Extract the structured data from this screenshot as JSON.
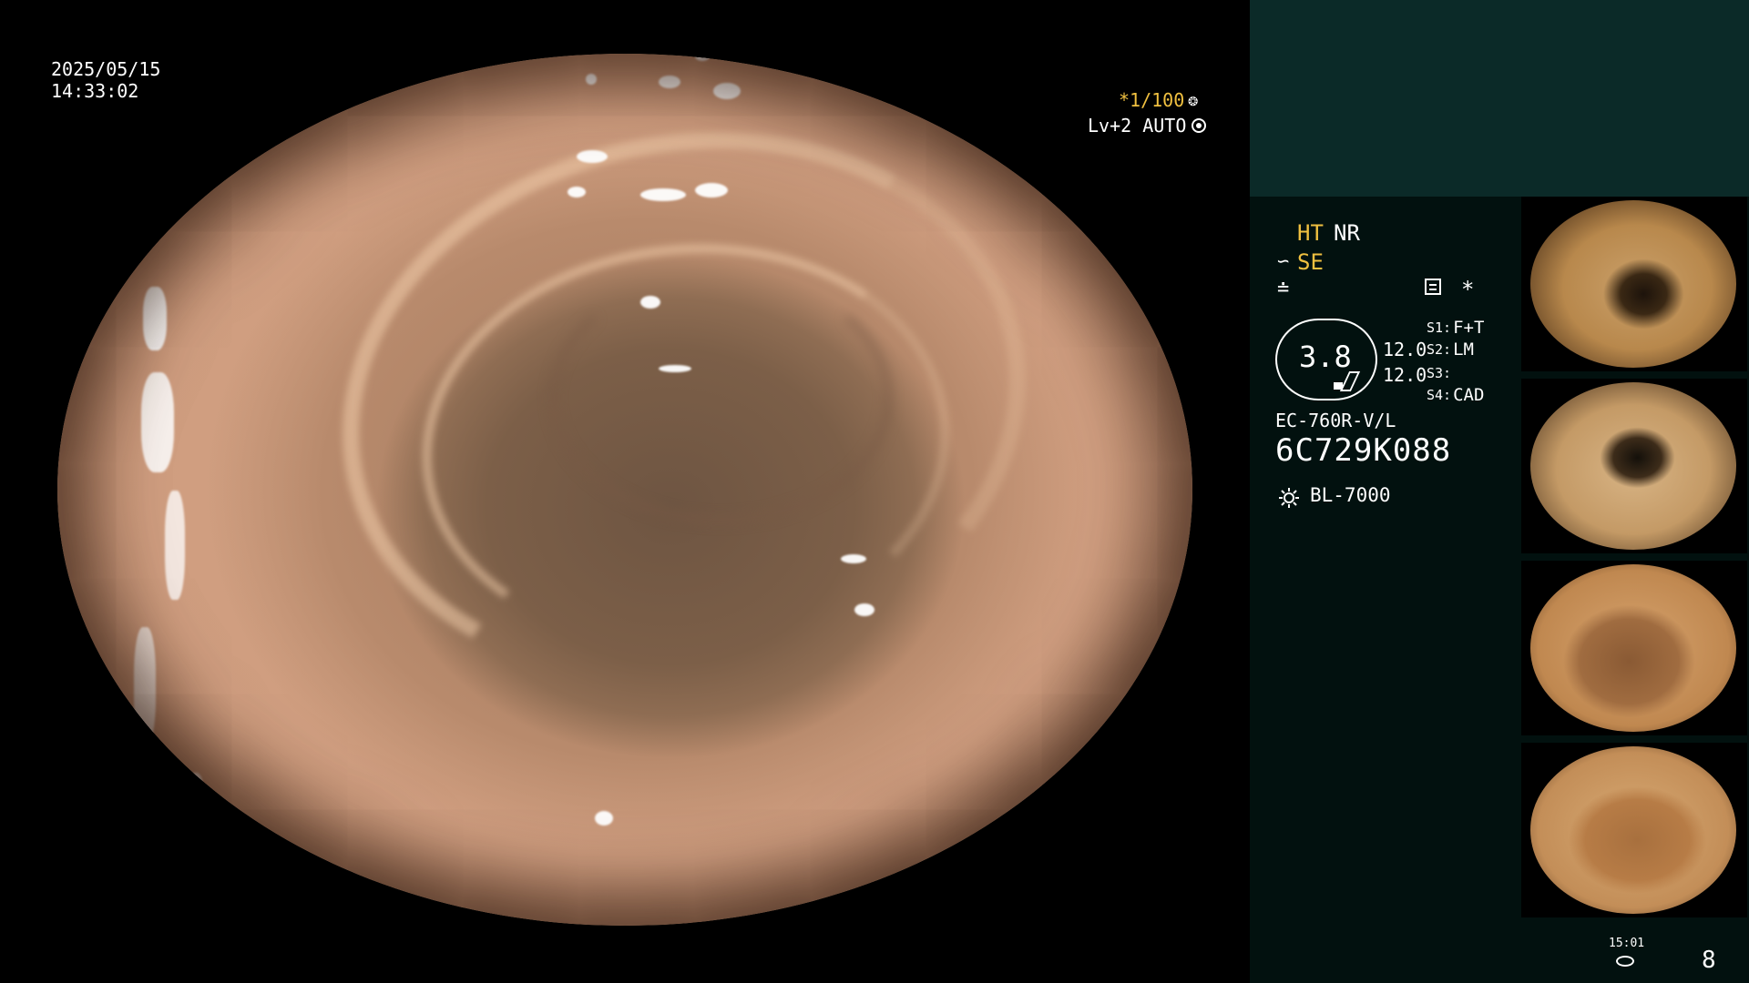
{
  "overlay": {
    "date": "2025/05/15",
    "time": "14:33:02",
    "shutter": "*1/100",
    "iris": "Lv+2 AUTO"
  },
  "panel": {
    "ht_label": "HT",
    "nr_label": "NR",
    "se_label": "SE",
    "main_value": "3.8",
    "value_a": "12.0",
    "value_b": "12.0",
    "switches": [
      {
        "key": "S1:",
        "value": "F+T"
      },
      {
        "key": "S2:",
        "value": "LM"
      },
      {
        "key": "S3:",
        "value": ""
      },
      {
        "key": "S4:",
        "value": "CAD"
      }
    ],
    "scope_model": "EC-760R-V/L",
    "serial_number": "6C729K088",
    "light_source": "BL-7000"
  },
  "footer": {
    "time": "15:01",
    "image_count": "8"
  },
  "colors": {
    "panel_background": "#02110f",
    "panel_header": "#0b2a28",
    "highlight_yellow": "#f0c040",
    "text": "#ffffff"
  },
  "icons": {
    "shutter": "gear-icon",
    "iris": "iris-icon",
    "se": "structure-enhance-icon",
    "freeze": "freeze-icon",
    "menu": "menu-icon",
    "star": "star-icon",
    "light": "sun-icon",
    "disk": "disk-icon"
  }
}
